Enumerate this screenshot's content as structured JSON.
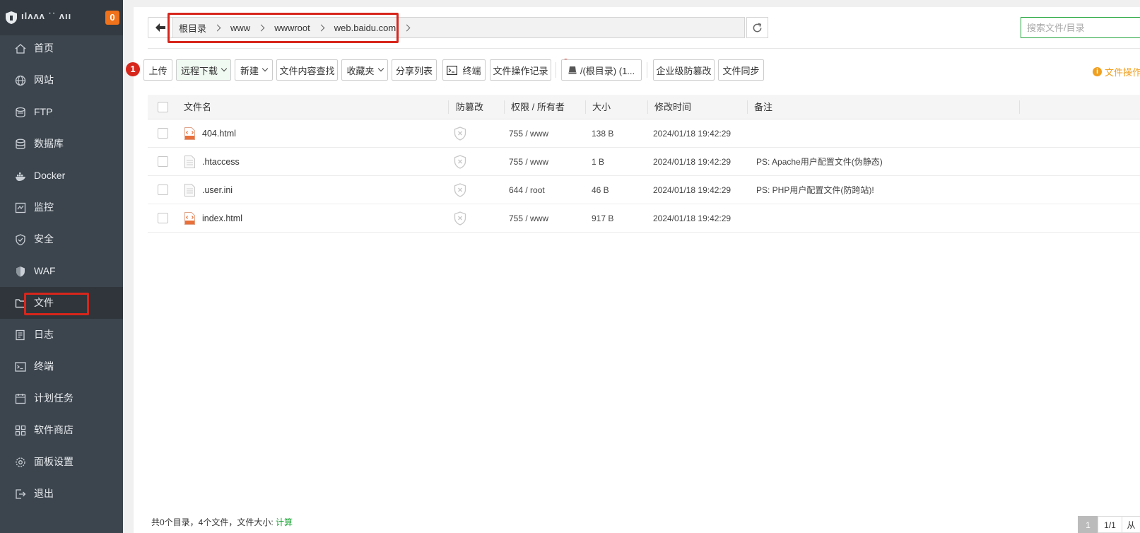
{
  "sidebar": {
    "brand": "ılʌʌʌ ˈˈ ʌıı",
    "notice_count": "0",
    "items": [
      {
        "label": "首页",
        "icon": "home-icon"
      },
      {
        "label": "网站",
        "icon": "globe-icon"
      },
      {
        "label": "FTP",
        "icon": "ftp-icon"
      },
      {
        "label": "数据库",
        "icon": "database-icon"
      },
      {
        "label": "Docker",
        "icon": "docker-icon"
      },
      {
        "label": "监控",
        "icon": "monitor-icon"
      },
      {
        "label": "安全",
        "icon": "shield-check-icon"
      },
      {
        "label": "WAF",
        "icon": "waf-shield-icon"
      },
      {
        "label": "文件",
        "icon": "folder-icon",
        "active": true
      },
      {
        "label": "日志",
        "icon": "log-icon"
      },
      {
        "label": "终端",
        "icon": "terminal-icon"
      },
      {
        "label": "计划任务",
        "icon": "calendar-icon"
      },
      {
        "label": "软件商店",
        "icon": "apps-grid-icon"
      },
      {
        "label": "面板设置",
        "icon": "settings-gear-icon"
      },
      {
        "label": "退出",
        "icon": "logout-icon"
      }
    ]
  },
  "path": {
    "crumbs": [
      "根目录",
      "www",
      "wwwroot",
      "web.baidu.com"
    ]
  },
  "search": {
    "placeholder": "搜索文件/目录"
  },
  "toolbar": {
    "step_number": "1",
    "upload": "上传",
    "remote_download": "远程下载",
    "new": "新建",
    "content_search": "文件内容查找",
    "favorites": "收藏夹",
    "share_list": "分享列表",
    "terminal": "终端",
    "op_log": "文件操作记录",
    "disk": "/(根目录) (1...",
    "tamper_proof": "企业级防篡改",
    "file_sync": "文件同步",
    "ops_hint": "文件操作"
  },
  "table": {
    "headers": {
      "name": "文件名",
      "tamper": "防篡改",
      "perm": "权限 / 所有者",
      "size": "大小",
      "mtime": "修改时间",
      "remark": "备注"
    },
    "rows": [
      {
        "name": "404.html",
        "type": "html",
        "perm": "755 / www",
        "size": "138 B",
        "mtime": "2024/01/18 19:42:29",
        "remark": ""
      },
      {
        "name": ".htaccess",
        "type": "text",
        "perm": "755 / www",
        "size": "1 B",
        "mtime": "2024/01/18 19:42:29",
        "remark": "PS: Apache用户配置文件(伪静态)"
      },
      {
        "name": ".user.ini",
        "type": "text",
        "perm": "644 / root",
        "size": "46 B",
        "mtime": "2024/01/18 19:42:29",
        "remark": "PS: PHP用户配置文件(防跨站)!"
      },
      {
        "name": "index.html",
        "type": "html",
        "perm": "755 / www",
        "size": "917 B",
        "mtime": "2024/01/18 19:42:29",
        "remark": ""
      }
    ]
  },
  "footer": {
    "summary": "共0个目录，4个文件，文件大小: ",
    "calc": "计算",
    "page_current": "1",
    "page_total": "1/1",
    "page_from": "从"
  },
  "colors": {
    "sidebar_bg": "#3c444d",
    "accent_green": "#20a53a",
    "annotation_red": "#d7261c",
    "badge_orange": "#f0721b"
  }
}
